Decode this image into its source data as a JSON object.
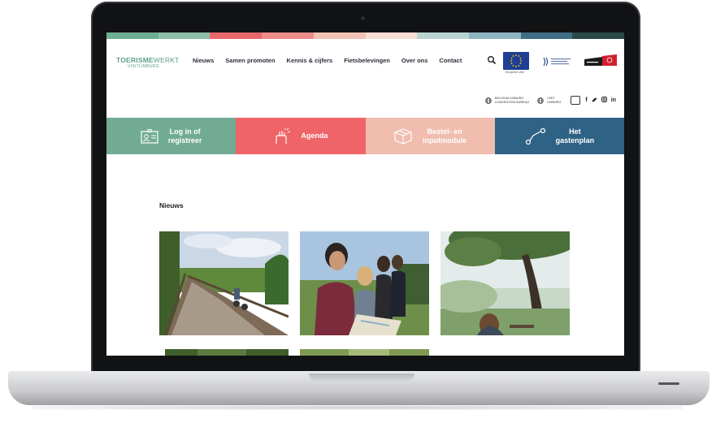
{
  "colors": {
    "strip": [
      "#6fae92",
      "#8dbfa9",
      "#e8686a",
      "#ee8c8a",
      "#f2c2b4",
      "#f6ddd1",
      "#b9d3d3",
      "#8fb4c1",
      "#3f6f86",
      "#2a4a4a"
    ],
    "green": "#72ab93",
    "red": "#ee6468",
    "peach": "#f0bdaf",
    "blue": "#2f6385"
  },
  "header": {
    "logo_bold": "TOERISME",
    "logo_light": "WERKT",
    "logo_sub": "VISITLIMBURG",
    "menu": [
      "Nieuws",
      "Samen promoten",
      "Kennis & cijfers",
      "Fietsbelevingen",
      "Over ons",
      "Contact"
    ],
    "eu_caption": "Europese Unie"
  },
  "utility": {
    "convention_line1": "BELGIUM LIMBURG",
    "convention_line2": "CONVENTION BUREAU",
    "visit_line1": "VISIT",
    "visit_line2": "LIMBURG",
    "social": [
      "f",
      "🐦",
      "◎",
      "in"
    ]
  },
  "quicklinks": [
    {
      "label_line1": "Log in of",
      "label_line2": "registreer",
      "icon": "id-card-icon"
    },
    {
      "label_line1": "Agenda",
      "label_line2": "",
      "icon": "party-hand-icon"
    },
    {
      "label_line1": "Bestel- en",
      "label_line2": "inputmodule",
      "icon": "box-icon"
    },
    {
      "label_line1": "Het",
      "label_line2": "gastenplan",
      "icon": "route-icon"
    }
  ],
  "news": {
    "heading": "Nieuws"
  }
}
